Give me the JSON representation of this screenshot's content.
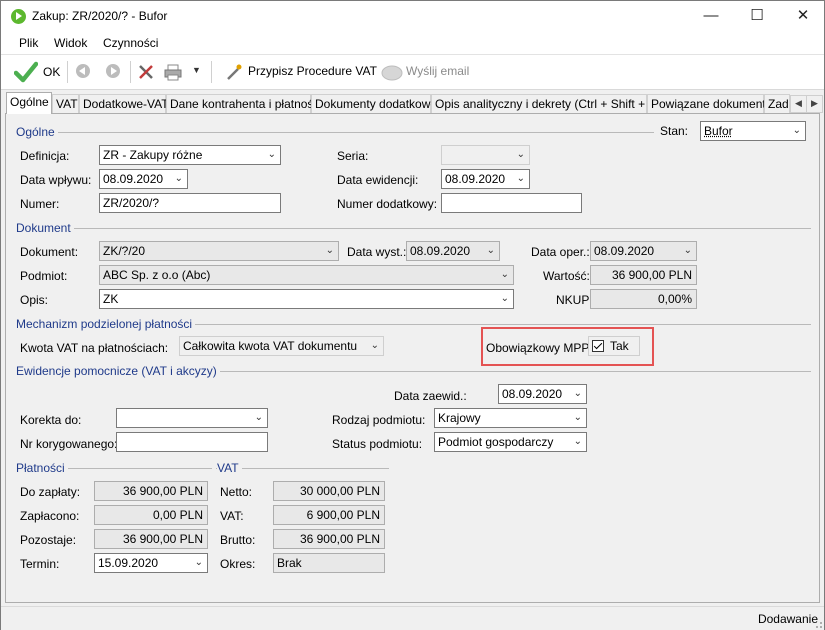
{
  "window": {
    "title": "Zakup: ZR/2020/? - Bufor"
  },
  "menu": [
    "Plik",
    "Widok",
    "Czynności"
  ],
  "toolbar": {
    "ok_label": "OK",
    "vat_label": "Przypisz Procedure VAT",
    "email_label": "Wyślij email"
  },
  "tabs": [
    "Ogólne",
    "VAT",
    "Dodatkowe-VAT",
    "Dane kontrahenta i płatności",
    "Dokumenty dodatkowe",
    "Opis analityczny i dekrety (Ctrl + Shift + D)",
    "Powiązane dokumenty",
    "Zad"
  ],
  "ogolne": {
    "section": "Ogólne",
    "stan_label": "Stan:",
    "stan_value": "Bufor",
    "definicja_label": "Definicja:",
    "definicja_value": "ZR - Zakupy różne",
    "seria_label": "Seria:",
    "data_wplywu_label": "Data wpływu:",
    "data_wplywu_value": "08.09.2020",
    "data_ewidencji_label": "Data ewidencji:",
    "data_ewidencji_value": "08.09.2020",
    "numer_label": "Numer:",
    "numer_value": "ZR/2020/?",
    "numer_dodatkowy_label": "Numer dodatkowy:",
    "numer_dodatkowy_value": ""
  },
  "dokument": {
    "section": "Dokument",
    "dokument_label": "Dokument:",
    "dokument_value": "ZK/?/20",
    "data_wyst_label": "Data wyst.:",
    "data_wyst_value": "08.09.2020",
    "data_oper_label": "Data oper.:",
    "data_oper_value": "08.09.2020",
    "podmiot_label": "Podmiot:",
    "podmiot_value": "ABC Sp. z o.o (Abc)",
    "wartosc_label": "Wartość:",
    "wartosc_value": "36 900,00 PLN",
    "opis_label": "Opis:",
    "opis_value": "ZK",
    "nkup_label": "NKUP:",
    "nkup_value": "0,00%"
  },
  "mpp": {
    "section": "Mechanizm podzielonej płatności",
    "kwota_label": "Kwota VAT na płatnościach:",
    "kwota_value": "Całkowita kwota VAT dokumentu",
    "obowiazkowy_label": "Obowiązkowy MPP:",
    "tak_label": "Tak",
    "checked": true
  },
  "ewidencje": {
    "section": "Ewidencje pomocnicze (VAT i akcyzy)",
    "data_zaewid_label": "Data zaewid.:",
    "data_zaewid_value": "08.09.2020",
    "korekta_label": "Korekta do:",
    "korekta_value": "",
    "rodzaj_label": "Rodzaj podmiotu:",
    "rodzaj_value": "Krajowy",
    "nr_korygowanego_label": "Nr korygowanego:",
    "nr_korygowanego_value": "",
    "status_label": "Status podmiotu:",
    "status_value": "Podmiot gospodarczy"
  },
  "platnosci": {
    "section": "Płatności",
    "do_zaplaty_label": "Do zapłaty:",
    "do_zaplaty_value": "36 900,00 PLN",
    "zaplacono_label": "Zapłacono:",
    "zaplacono_value": "0,00 PLN",
    "pozostaje_label": "Pozostaje:",
    "pozostaje_value": "36 900,00 PLN",
    "termin_label": "Termin:",
    "termin_value": "15.09.2020"
  },
  "vat": {
    "section": "VAT",
    "netto_label": "Netto:",
    "netto_value": "30 000,00 PLN",
    "vat_label": "VAT:",
    "vat_value": "6 900,00 PLN",
    "brutto_label": "Brutto:",
    "brutto_value": "36 900,00 PLN",
    "okres_label": "Okres:",
    "okres_value": "Brak"
  },
  "status": {
    "mode": "Dodawanie"
  },
  "colors": {
    "section_text": "#1f3a8a",
    "highlight": "#e45353",
    "ok_check": "#4caf50"
  }
}
